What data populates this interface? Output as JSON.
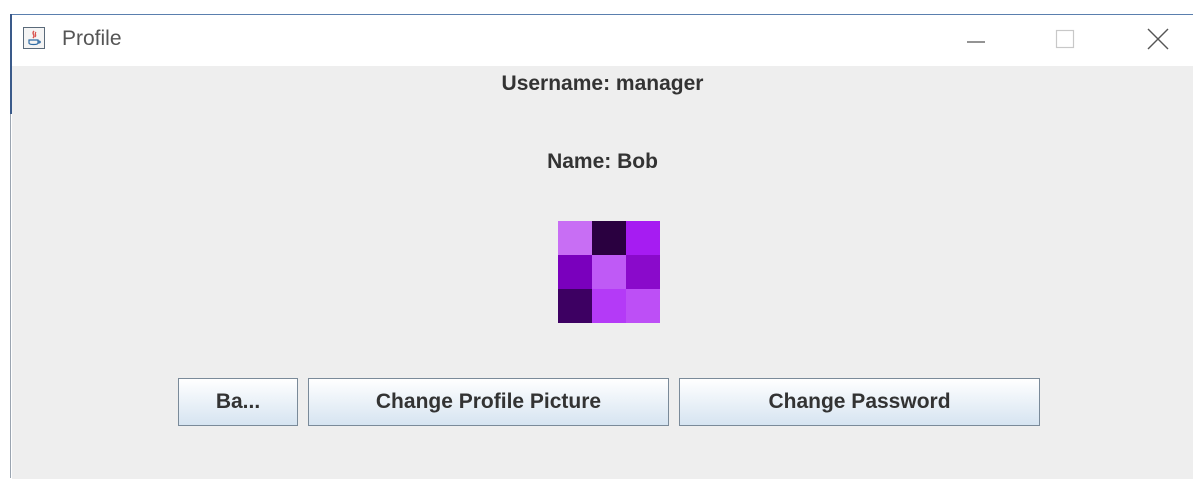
{
  "window": {
    "title": "Profile"
  },
  "profile": {
    "username_text": "Username: manager",
    "name_text": "Name: Bob",
    "avatar_pixels": [
      "#c86ef4",
      "#2a0040",
      "#a61cf2",
      "#7a00bd",
      "#bf5af6",
      "#8a0acb",
      "#3d0062",
      "#b43af7",
      "#bd4ff6"
    ]
  },
  "buttons": {
    "back_label": "Ba...",
    "change_picture_label": "Change Profile Picture",
    "change_password_label": "Change Password"
  },
  "window_controls": [
    "minimize-icon",
    "maximize-icon",
    "close-icon"
  ]
}
